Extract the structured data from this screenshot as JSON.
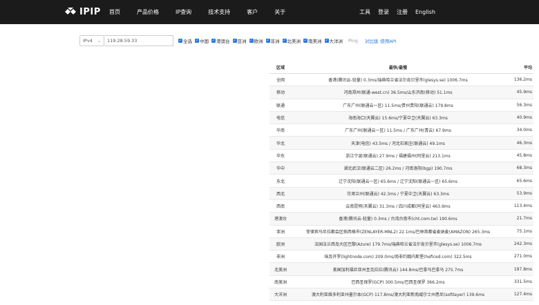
{
  "brand": {
    "logo_text": "IPIP"
  },
  "nav": {
    "left": [
      "首页",
      "产品价格",
      "IP查询",
      "技术支持",
      "客户",
      "关于"
    ],
    "right": [
      "工具",
      "登录",
      "注册",
      "English"
    ]
  },
  "toolbar": {
    "ip_version": "IPv4",
    "ip_value": "119.28.59.33",
    "checkboxes": [
      "全选",
      "中国",
      "港澳台",
      "亚洲",
      "欧洲",
      "非洲",
      "北美洲",
      "南美洲",
      "大洋洲"
    ],
    "ping_label": "Ping",
    "compare_link": "对比版",
    "api_link": "使用API"
  },
  "table": {
    "headers": {
      "region": "区域",
      "best": "最快/最慢",
      "avg": "平均"
    },
    "rows": [
      {
        "region": "全网",
        "best": "香港(腾讯云-轻量) 0.3ms/瑞典哈兰省法尔肯贝里市(glesys.se) 1006.7ms",
        "avg": "136.2ms"
      },
      {
        "region": "移动",
        "best": "河南郑州(联通-west.cn) 36.5ms/山东济南(移动) 51.1ms",
        "avg": "45.9ms"
      },
      {
        "region": "联通",
        "best": "广东广州(联通云一区) 11.5ms/贵州贵阳(联通云) 179.8ms",
        "avg": "56.3ms"
      },
      {
        "region": "电信",
        "best": "海南海口(天翼云) 15.6ms/宁夏中卫(天翼云) 63.3ms",
        "avg": "40.9ms"
      },
      {
        "region": "华南",
        "best": "广东广州(联通云一区) 11.5ms / 广东广州(青云) 67.9ms",
        "avg": "34.0ms"
      },
      {
        "region": "华北",
        "best": "天津(电信) 43.5ms / 河北石家庄(联通云) 49.1ms",
        "avg": "46.3ms"
      },
      {
        "region": "华东",
        "best": "浙江宁波(联通云) 27.9ms / 福建福州(阿里云) 213.1ms",
        "avg": "45.8ms"
      },
      {
        "region": "华中",
        "best": "湖北武汉(联通云二区) 26.2ms / 河南洛阳(bgp) 190.7ms",
        "avg": "68.3ms"
      },
      {
        "region": "东北",
        "best": "辽宁沈阳(联通云一区) 65.6ms / 辽宁沈阳(联通云一区) 65.6ms",
        "avg": "65.6ms"
      },
      {
        "region": "西北",
        "best": "甘肃兰州(联通云) 42.3ms / 宁夏中卫(天翼云) 63.3ms",
        "avg": "53.9ms"
      },
      {
        "region": "西南",
        "best": "云南昆明(天翼云) 31.3ms / 四川成都(阿里云) 463.9ms",
        "avg": "113.4ms"
      },
      {
        "region": "港澳台",
        "best": "香港(腾讯云-轻量) 0.3ms / 台湾台南市(cht.com.tw) 190.6ms",
        "avg": "21.7ms"
      },
      {
        "region": "亚洲",
        "best": "菲律宾马尼拉都会区帕西格市(ZENLAYER-MNL2) 22.1ms/巴林首都省麦纳麦(AMAZON) 265.3ms",
        "avg": "75.1ms"
      },
      {
        "region": "欧洲",
        "best": "法国法兰西岛大区巴黎(Azure) 179.7ms/瑞典哈兰省法尔肯贝里市(glesys.se) 1006.7ms",
        "avg": "242.3ms"
      },
      {
        "region": "非洲",
        "best": "埃及开罗(lightnode.com) 209.0ms/南非约翰内斯堡(heficed.com) 322.5ms",
        "avg": "271.0ms"
      },
      {
        "region": "北美洲",
        "best": "美国加利福尼亚州圣克拉拉(腾讯云) 144.8ms/巴拿马巴拿马 275.7ms",
        "avg": "197.8ms"
      },
      {
        "region": "南美洲",
        "best": "巴西圣保罗(GCP) 300.5ms/巴西圣保罗 366.2ms",
        "avg": "331.5ms"
      },
      {
        "region": "大洋洲",
        "best": "澳大利亚维多利亚州墨尔本(GCP) 117.8ms/澳大利亚新南威尔士州悉尼(softlayer) 139.6ms",
        "avg": "127.4ms"
      }
    ]
  }
}
